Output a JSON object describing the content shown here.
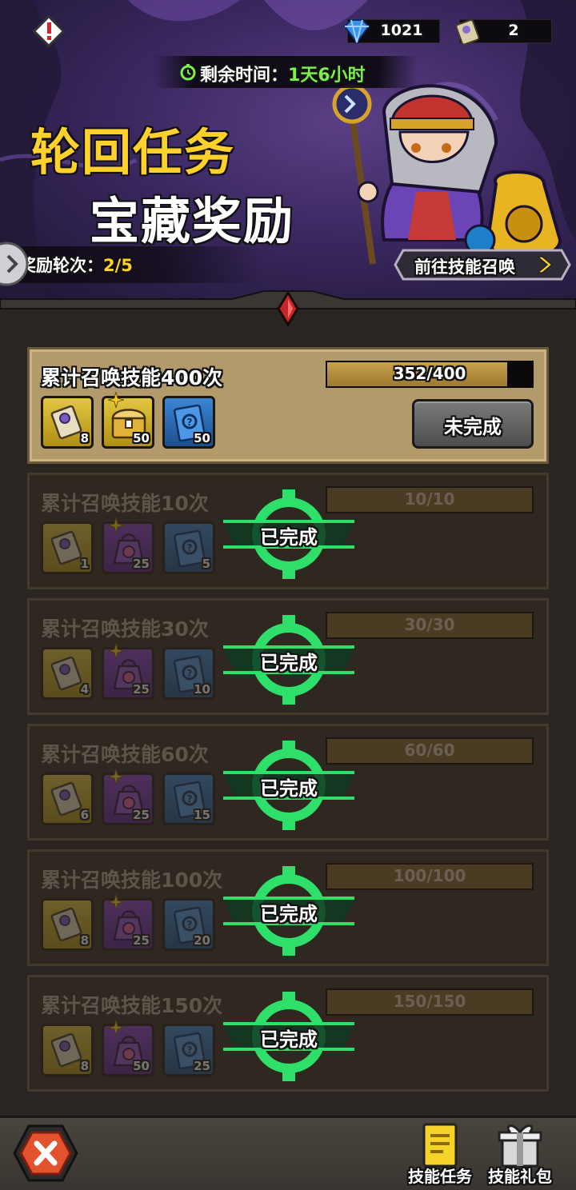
{
  "header": {
    "currencies": [
      {
        "icon": "diamond-icon",
        "value": "1021"
      },
      {
        "icon": "skill-scroll-icon",
        "value": "2"
      }
    ],
    "timer_label": "剩余时间：",
    "timer_value": "1天6小时",
    "title_line1": "轮回任务",
    "title_line2": "宝藏奖励",
    "round_label": "奖励轮次：",
    "round_value": "2/5",
    "goto_button": "前往技能召唤"
  },
  "tasks": [
    {
      "name": "累计召唤技能400次",
      "progress_text": "352/400",
      "progress": 0.88,
      "status": "active",
      "button": "未完成",
      "rewards": [
        {
          "type": "scroll",
          "qty": "8"
        },
        {
          "type": "chest",
          "qty": "50"
        },
        {
          "type": "card",
          "qty": "50"
        }
      ]
    },
    {
      "name": "累计召唤技能10次",
      "progress_text": "10/10",
      "progress": 1.0,
      "status": "done",
      "stamp": "已完成",
      "rewards": [
        {
          "type": "scroll",
          "qty": "1"
        },
        {
          "type": "bag",
          "qty": "25"
        },
        {
          "type": "card",
          "qty": "5"
        }
      ]
    },
    {
      "name": "累计召唤技能30次",
      "progress_text": "30/30",
      "progress": 1.0,
      "status": "done",
      "stamp": "已完成",
      "rewards": [
        {
          "type": "scroll",
          "qty": "4"
        },
        {
          "type": "bag",
          "qty": "25"
        },
        {
          "type": "card",
          "qty": "10"
        }
      ]
    },
    {
      "name": "累计召唤技能60次",
      "progress_text": "60/60",
      "progress": 1.0,
      "status": "done",
      "stamp": "已完成",
      "rewards": [
        {
          "type": "scroll",
          "qty": "6"
        },
        {
          "type": "bag",
          "qty": "25"
        },
        {
          "type": "card",
          "qty": "15"
        }
      ]
    },
    {
      "name": "累计召唤技能100次",
      "progress_text": "100/100",
      "progress": 1.0,
      "status": "done",
      "stamp": "已完成",
      "rewards": [
        {
          "type": "scroll",
          "qty": "8"
        },
        {
          "type": "bag",
          "qty": "25"
        },
        {
          "type": "card",
          "qty": "20"
        }
      ]
    },
    {
      "name": "累计召唤技能150次",
      "progress_text": "150/150",
      "progress": 1.0,
      "status": "done",
      "stamp": "已完成",
      "rewards": [
        {
          "type": "scroll",
          "qty": "8"
        },
        {
          "type": "bag",
          "qty": "50"
        },
        {
          "type": "card",
          "qty": "25"
        }
      ]
    }
  ],
  "bottom": {
    "close_icon": "close-icon",
    "nav": [
      {
        "label": "技能任务",
        "icon": "skill-task-icon"
      },
      {
        "label": "技能礼包",
        "icon": "gift-icon"
      }
    ]
  },
  "colors": {
    "accent_yellow": "#ffd12a",
    "timer_green": "#7cf04a",
    "done_green": "#2ee06a"
  }
}
